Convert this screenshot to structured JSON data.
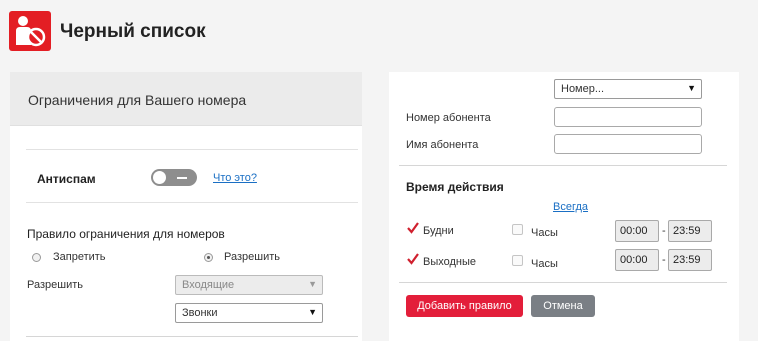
{
  "header": {
    "title": "Черный список",
    "logo_icon": "blacklist-person-icon"
  },
  "left_panel": {
    "title": "Ограничения для Вашего номера",
    "antispam": {
      "label": "Антиспам",
      "toggle_state": "off",
      "help_link": "Что это?"
    },
    "rule": {
      "title": "Правило ограничения для номеров",
      "options": [
        "Запретить",
        "Разрешить"
      ],
      "selected": "Разрешить",
      "allow_label": "Разрешить",
      "direction_select": "Входящие",
      "type_select": "Звонки"
    }
  },
  "right_panel": {
    "number_select": "Номер...",
    "subscriber_number_label": "Номер абонента",
    "subscriber_name_label": "Имя абонента",
    "time_title": "Время действия",
    "always_link": "Всегда",
    "weekdays": {
      "label": "Будни",
      "checked": true,
      "hours_label": "Часы",
      "from": "00:00",
      "to": "23:59"
    },
    "weekend": {
      "label": "Выходные",
      "checked": true,
      "hours_label": "Часы",
      "from": "00:00",
      "to": "23:59"
    },
    "dash": "-",
    "add_button": "Добавить правило",
    "cancel_button": "Отмена"
  },
  "colors": {
    "brand": "#e31e24",
    "link": "#1a6fc4",
    "cancel": "#7a7f85"
  }
}
